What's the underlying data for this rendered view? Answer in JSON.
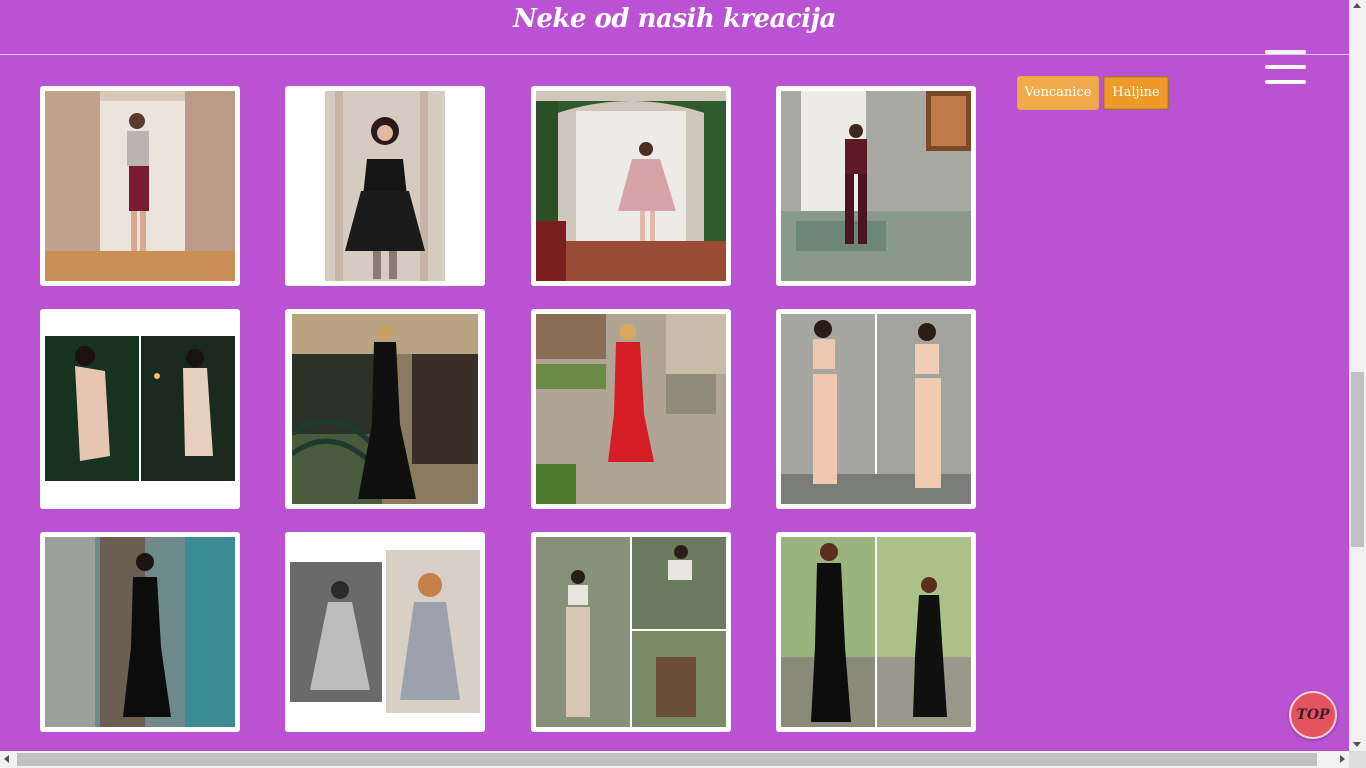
{
  "header": {
    "title": "Neke od nasih kreacija",
    "menu_icon": "hamburger-menu-icon"
  },
  "filters": [
    {
      "label": "Vencanice"
    },
    {
      "label": "Haljine"
    }
  ],
  "gallery": {
    "items": [
      {
        "alt": "Sequin top and burgundy skirt"
      },
      {
        "alt": "Black strapless mini dress"
      },
      {
        "alt": "Pink lace cocktail dress"
      },
      {
        "alt": "Burgundy lace jumpsuit"
      },
      {
        "alt": "Nude fitted dress"
      },
      {
        "alt": "Black halter gown"
      },
      {
        "alt": "Red long gown"
      },
      {
        "alt": "Beige crop top and trousers"
      },
      {
        "alt": "Black strapless gown"
      },
      {
        "alt": "Grey sparkly dress"
      },
      {
        "alt": "White crop top and trousers"
      },
      {
        "alt": "Black lace gown with slit"
      }
    ]
  },
  "top_button": {
    "label": "TOP"
  },
  "colors": {
    "background": "#bb52d4",
    "filter_vencanice": "#f1a94a",
    "filter_haljine": "#ef9928",
    "top_button": "#e4545f"
  }
}
